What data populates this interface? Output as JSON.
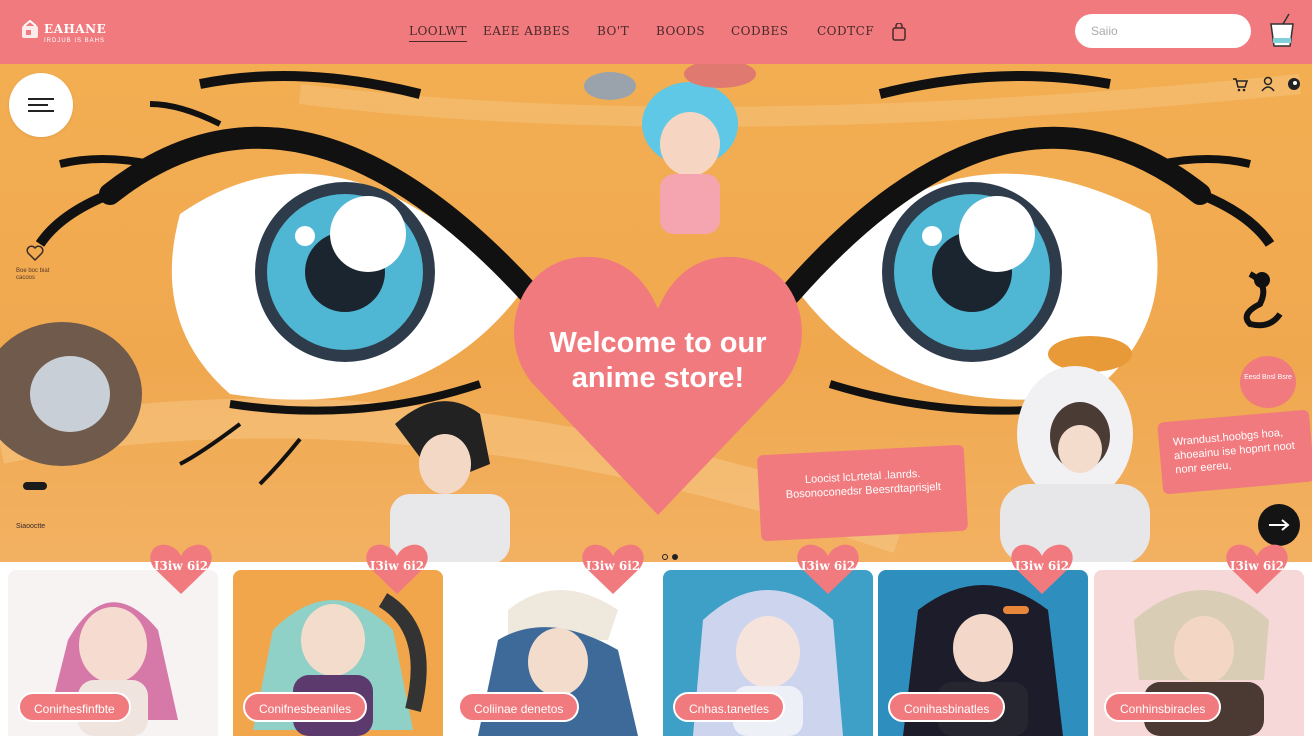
{
  "brand": {
    "title": "EAHANE",
    "tagline": "IRDJUB IS BAHS",
    "accent": "#f07a7e",
    "hero_bg": "#f2ac50"
  },
  "nav": {
    "links": [
      "LOOLWT",
      "EAEE ABBES",
      "BO'T",
      "BOODS",
      "CODBES",
      "CODTCF"
    ],
    "bag_icon": "shopping-bag-icon",
    "search_placeholder": "Saiio",
    "cup_icon": "cup-icon"
  },
  "hero": {
    "welcome": "Welcome to our anime store!",
    "icons": [
      "cart-icon",
      "user-icon",
      "circle-icon"
    ],
    "side_caption": "Boe boc biat cacoos",
    "side_label": "Siaooctte",
    "bubble_mid": "Loocist lcLrtetal .lanrds. Bosonoconedsr Beesrdtaprisjelt",
    "bubble_right": "Wrandust.hoobgs hoa, ahoeainu ise hopnrt noot nonr eereu,",
    "badge_round": "Eesd Bnsl Bsre"
  },
  "products": [
    {
      "price": "I3iw 6i2",
      "label": "Conirhesfinfbte"
    },
    {
      "price": "I3iw 6i2",
      "label": "Conifnesbeaniles"
    },
    {
      "price": "I3iw 6i2",
      "label": "Coliinae denetos"
    },
    {
      "price": "I3iw 6i2",
      "label": "Cnhas.tanetles"
    },
    {
      "price": "I3iw 6i2",
      "label": "Conihasbinatles"
    },
    {
      "price": "I3iw 6i2",
      "label": "Conhinsbiracles"
    }
  ]
}
